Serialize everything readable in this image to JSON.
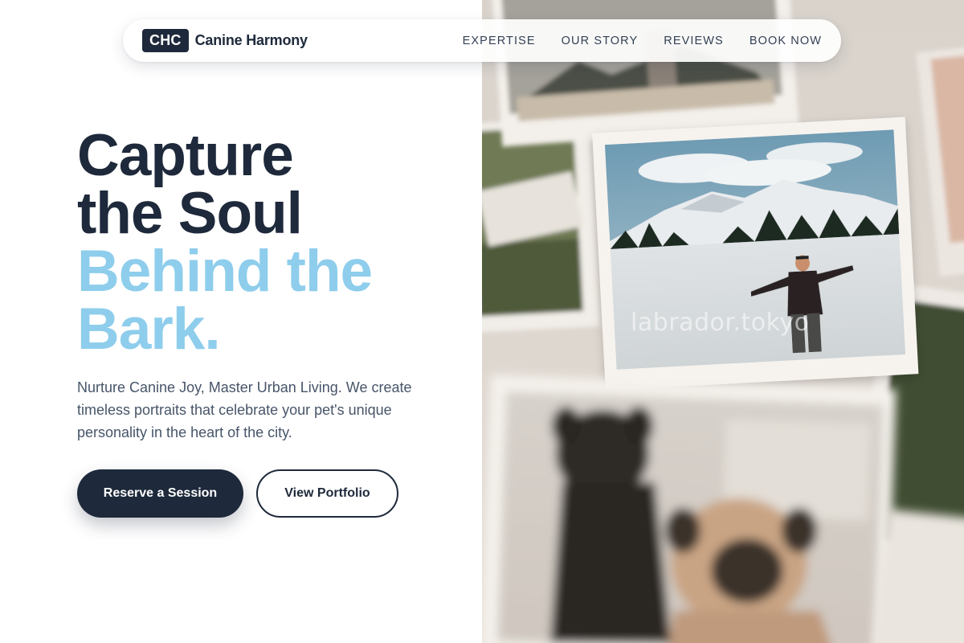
{
  "brand": {
    "badge": "CHC",
    "name": "Canine Harmony"
  },
  "nav": {
    "links": [
      {
        "label": "EXPERTISE"
      },
      {
        "label": "OUR STORY"
      },
      {
        "label": "REVIEWS"
      },
      {
        "label": "BOOK NOW"
      }
    ]
  },
  "hero": {
    "title_lines": [
      "Capture",
      "the Soul",
      "Behind the",
      "Bark."
    ],
    "subtitle": "Nurture Canine Joy, Master Urban Living. We create timeless portraits that celebrate your pet's unique personality in the heart of the city.",
    "primary_cta": "Reserve a Session",
    "secondary_cta": "View Portfolio"
  },
  "image": {
    "watermark": "labrador.tokyo"
  },
  "colors": {
    "primary": "#1e293b",
    "accent": "#8ecdec",
    "body_text": "#475569",
    "background": "#ffffff"
  }
}
